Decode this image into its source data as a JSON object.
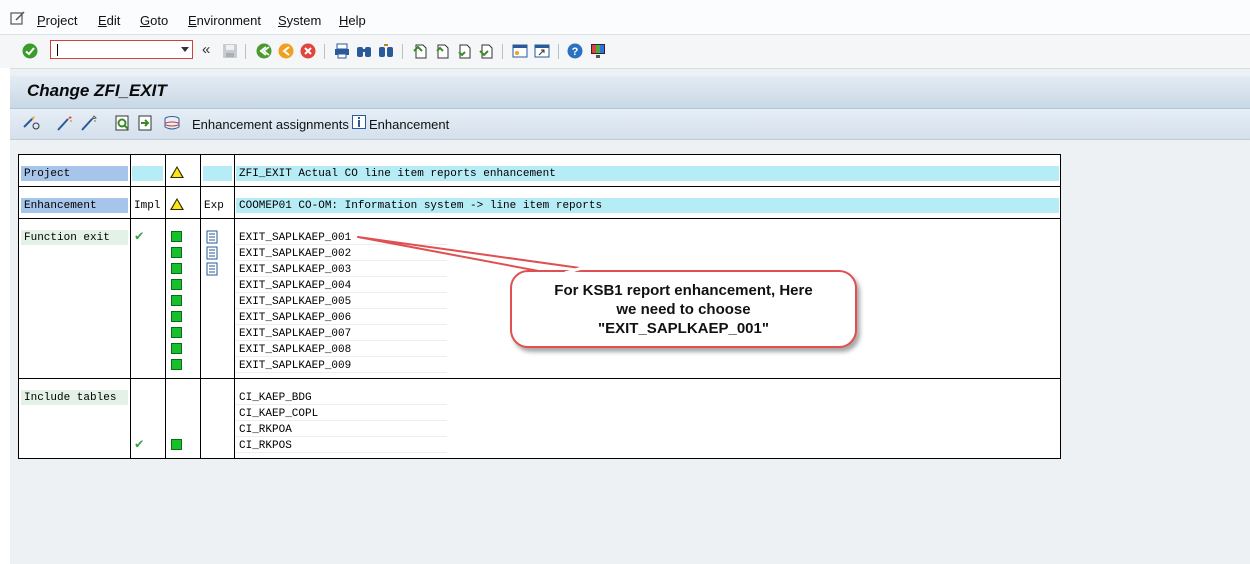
{
  "menu": [
    "Project",
    "Edit",
    "Goto",
    "Environment",
    "System",
    "Help"
  ],
  "command_field": {
    "value": ""
  },
  "page_title": "Change ZFI_EXIT",
  "app_toolbar": {
    "assignments_label": "Enhancement assignments",
    "enhancement_label": "Enhancement"
  },
  "grid": {
    "project": {
      "label": "Project",
      "text": "ZFI_EXIT Actual CO line item reports enhancement"
    },
    "enhancement": {
      "label": "Enhancement",
      "impl_header": "Impl",
      "exp_header": "Exp",
      "text": "COOMEP01 CO-OM: Information system -> line item reports"
    },
    "function_exit": {
      "label": "Function exit",
      "items": [
        "EXIT_SAPLKAEP_001",
        "EXIT_SAPLKAEP_002",
        "EXIT_SAPLKAEP_003",
        "EXIT_SAPLKAEP_004",
        "EXIT_SAPLKAEP_005",
        "EXIT_SAPLKAEP_006",
        "EXIT_SAPLKAEP_007",
        "EXIT_SAPLKAEP_008",
        "EXIT_SAPLKAEP_009"
      ]
    },
    "include_tables": {
      "label": "Include tables",
      "items": [
        "CI_KAEP_BDG",
        "CI_KAEP_COPL",
        "CI_RKPOA",
        "CI_RKPOS"
      ]
    }
  },
  "callout": {
    "lines": [
      "For KSB1 report enhancement, Here",
      "we need to choose",
      "\"EXIT_SAPLKAEP_001\""
    ],
    "color": "#e05050"
  },
  "colors": {
    "status_green": "#15c02a",
    "warning_yellow": "#ffe31a",
    "highlight_cyan": "#b6ecf6",
    "label_blue": "#a7c4ea"
  }
}
